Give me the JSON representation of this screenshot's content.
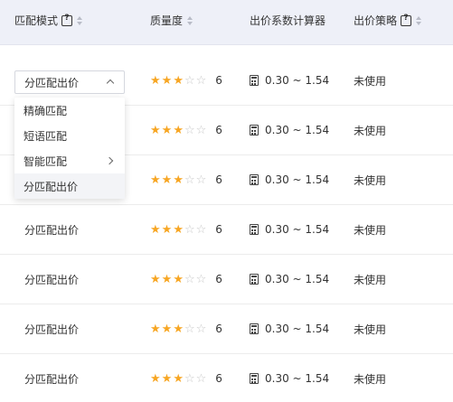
{
  "header": {
    "match_mode": "匹配模式",
    "quality": "质量度",
    "bid_calc": "出价系数计算器",
    "bid_strategy": "出价策略"
  },
  "dropdown": {
    "current_value": "分匹配出价",
    "options": [
      "精确匹配",
      "短语匹配",
      "智能匹配",
      "分匹配出价"
    ],
    "selected_index": 3
  },
  "rows": [
    {
      "mode": "分匹配出价",
      "stars_filled": 3,
      "stars_total": 5,
      "quality": "6",
      "calc": "0.30 ~ 1.54",
      "strategy": "未使用"
    },
    {
      "mode": "分匹配出价",
      "stars_filled": 3,
      "stars_total": 5,
      "quality": "6",
      "calc": "0.30 ~ 1.54",
      "strategy": "未使用"
    },
    {
      "mode": "分匹配出价",
      "stars_filled": 3,
      "stars_total": 5,
      "quality": "6",
      "calc": "0.30 ~ 1.54",
      "strategy": "未使用"
    },
    {
      "mode": "分匹配出价",
      "stars_filled": 3,
      "stars_total": 5,
      "quality": "6",
      "calc": "0.30 ~ 1.54",
      "strategy": "未使用"
    },
    {
      "mode": "分匹配出价",
      "stars_filled": 3,
      "stars_total": 5,
      "quality": "6",
      "calc": "0.30 ~ 1.54",
      "strategy": "未使用"
    },
    {
      "mode": "分匹配出价",
      "stars_filled": 3,
      "stars_total": 5,
      "quality": "6",
      "calc": "0.30 ~ 1.54",
      "strategy": "未使用"
    },
    {
      "mode": "分匹配出价",
      "stars_filled": 3,
      "stars_total": 5,
      "quality": "6",
      "calc": "0.30 ~ 1.54",
      "strategy": "未使用"
    }
  ],
  "colors": {
    "header_bg": "#eef0f8",
    "star_on": "#f7a623",
    "star_off": "#c8c8c8"
  }
}
